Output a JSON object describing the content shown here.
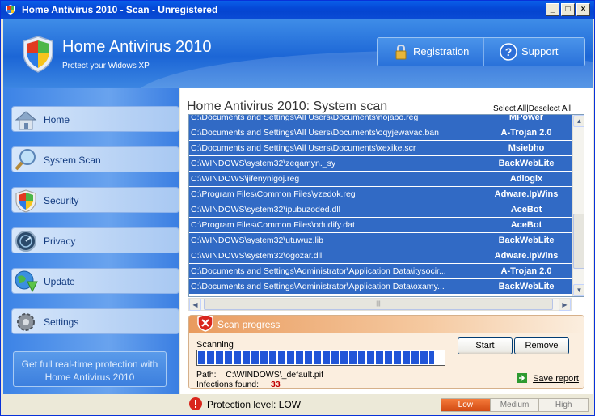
{
  "window": {
    "title": "Home Antivirus 2010 - Scan - Unregistered"
  },
  "header": {
    "app_name": "Home Antivirus 2010",
    "tagline": "Protect your Widows XP",
    "registration_label": "Registration",
    "support_label": "Support"
  },
  "sidebar": {
    "items": [
      {
        "label": "Home",
        "icon": "home-icon"
      },
      {
        "label": "System Scan",
        "icon": "magnifier-icon"
      },
      {
        "label": "Security",
        "icon": "shield-icon"
      },
      {
        "label": "Privacy",
        "icon": "privacy-icon"
      },
      {
        "label": "Update",
        "icon": "globe-download-icon"
      },
      {
        "label": "Settings",
        "icon": "gear-icon"
      }
    ],
    "promo": "Get full real-time protection with Home Antivirus 2010"
  },
  "main": {
    "title": "Home Antivirus 2010: System scan",
    "select_all": "Select All",
    "deselect_all": "Deselect All",
    "rows": [
      {
        "path": "C:\\Documents and Settings\\All Users\\Documents\\nojabo.reg",
        "threat": "MPower"
      },
      {
        "path": "C:\\Documents and Settings\\All Users\\Documents\\oqyjewavac.ban",
        "threat": "A-Trojan 2.0"
      },
      {
        "path": "C:\\Documents and Settings\\All Users\\Documents\\xexike.scr",
        "threat": "Msiebho"
      },
      {
        "path": "C:\\WINDOWS\\system32\\zeqamyn._sy",
        "threat": "BackWebLite"
      },
      {
        "path": "C:\\WINDOWS\\jifenynigoj.reg",
        "threat": "Adlogix"
      },
      {
        "path": "C:\\Program Files\\Common Files\\yzedok.reg",
        "threat": "Adware.IpWins"
      },
      {
        "path": "C:\\WINDOWS\\system32\\ipubuzoded.dll",
        "threat": "AceBot"
      },
      {
        "path": "C:\\Program Files\\Common Files\\odudify.dat",
        "threat": "AceBot"
      },
      {
        "path": "C:\\WINDOWS\\system32\\utuwuz.lib",
        "threat": "BackWebLite"
      },
      {
        "path": "C:\\WINDOWS\\system32\\ogozar.dll",
        "threat": "Adware.IpWins"
      },
      {
        "path": "C:\\Documents and Settings\\Administrator\\Application Data\\itysocir...",
        "threat": "A-Trojan 2.0"
      },
      {
        "path": "C:\\Documents and Settings\\Administrator\\Application Data\\oxamy...",
        "threat": "BackWebLite"
      }
    ]
  },
  "scan": {
    "heading": "Scan progress",
    "status": "Scanning",
    "progress": 0.96,
    "path_label": "Path:",
    "path_value": "C:\\WINDOWS\\_default.pif",
    "infections_label": "Infections found:",
    "infections_count": "33",
    "start_label": "Start",
    "remove_label": "Remove",
    "save_report_label": "Save report"
  },
  "status": {
    "protection_text": "Protection level: LOW",
    "levels": [
      "Low",
      "Medium",
      "High"
    ],
    "active_level": "Low"
  }
}
